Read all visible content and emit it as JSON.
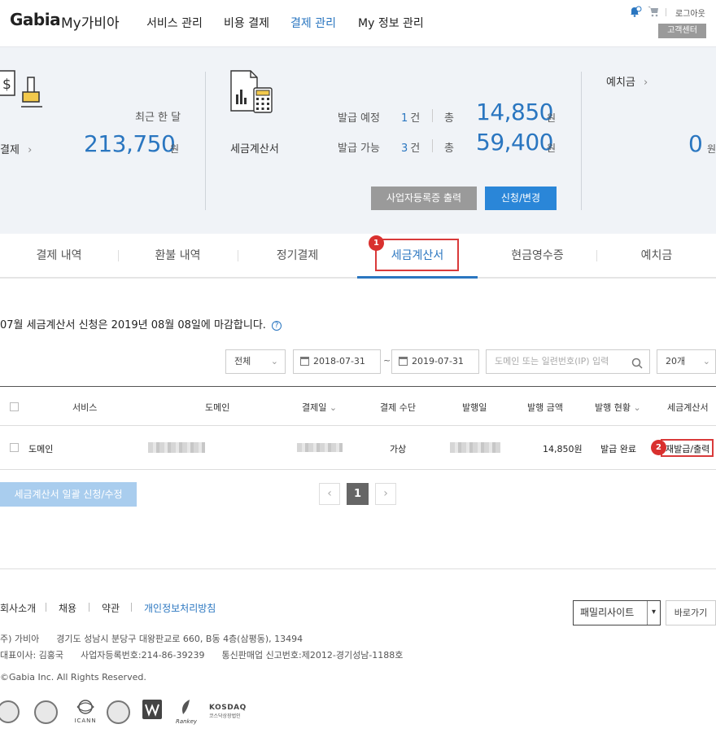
{
  "header": {
    "logo": "Gabia",
    "logo_sub": "My가비아",
    "nav": [
      "서비스 관리",
      "비용 결제",
      "결제 관리",
      "My 정보 관리"
    ],
    "logout": "로그아웃",
    "customer_center": "고객센터"
  },
  "summary": {
    "payment": {
      "recent_label": "최근 한 달",
      "label": "결제",
      "amount": "213,750",
      "unit": "원"
    },
    "tax_invoice": {
      "label": "세금계산서",
      "scheduled_label": "발급 예정",
      "scheduled_count": "1",
      "available_label": "발급 가능",
      "available_count": "3",
      "count_unit": "건",
      "total_label": "총",
      "scheduled_total": "14,850",
      "available_total": "59,400",
      "unit": "원",
      "btn_print": "사업자등록증 출력",
      "btn_apply": "신청/변경"
    },
    "deposit": {
      "label": "예치금",
      "amount": "0",
      "unit": "원"
    }
  },
  "tabs": [
    "결제 내역",
    "환불 내역",
    "정기결제",
    "세금계산서",
    "현금영수증",
    "예치금"
  ],
  "callouts": [
    "1",
    "2"
  ],
  "notice": "07월 세금계산서 신청은 2019년 08월 08일에 마감합니다.",
  "filters": {
    "type": "전체",
    "date_from": "2018-07-31",
    "date_sep": "~",
    "date_to": "2019-07-31",
    "search_placeholder": "도메인 또는 일련번호(IP) 입력",
    "page_size": "20개"
  },
  "table": {
    "headers": [
      "서비스",
      "도메인",
      "결제일",
      "결제 수단",
      "발행일",
      "발행 금액",
      "발행 현황",
      "세금계산서"
    ],
    "row": {
      "service": "도메인",
      "method": "가상",
      "amount": "14,850원",
      "status": "발급 완료",
      "action": "재발급/출력"
    }
  },
  "bulk_button": "세금계산서 일괄 신청/수정",
  "pagination": {
    "prev": "‹",
    "current": "1",
    "next": "›"
  },
  "footer": {
    "links": [
      "회사소개",
      "채용",
      "약관",
      "개인정보처리방침"
    ],
    "family_site": "패밀리사이트",
    "go_button": "바로가기",
    "company_line": "주) 가비아      경기도 성남시 분당구 대왕판교로 660, B동 4층(삼평동), 13494",
    "ceo_line": "대표이사: 김홍국      사업자등록번호:214-86-39239      통신판매업 신고번호:제2012-경기성남-1188호",
    "copyright": "©Gabia Inc. All Rights Reserved.",
    "badges": [
      "ICANN",
      "Rankey",
      "KOSDAQ",
      "코스닥상장법인"
    ]
  },
  "colors": {
    "accent": "#2a76c0",
    "callout": "#d93a3a",
    "panel_bg": "#f0f3f7"
  }
}
